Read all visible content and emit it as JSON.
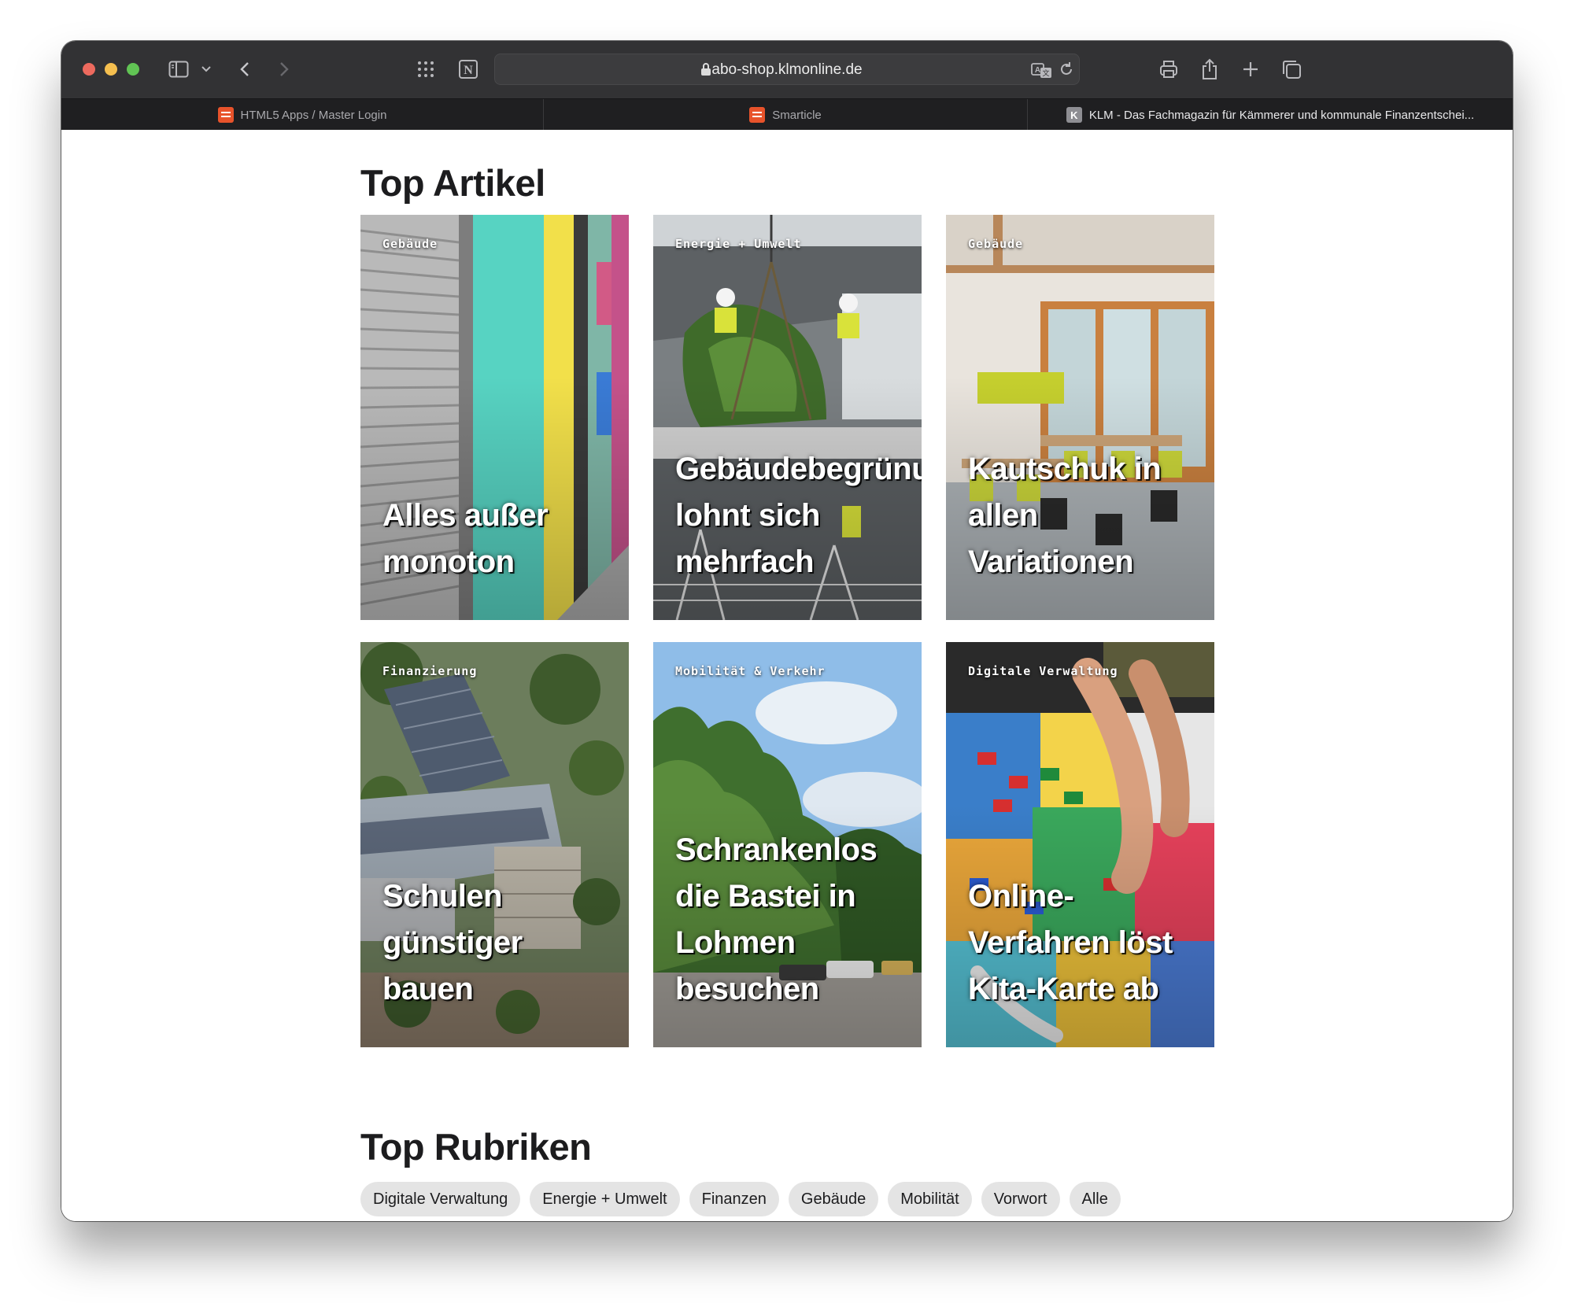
{
  "browser": {
    "url": "abo-shop.klmonline.de",
    "tabs": [
      {
        "label": "HTML5 Apps / Master Login",
        "favicon": "html5-apps-favicon"
      },
      {
        "label": "Smarticle",
        "favicon": "smarticle-favicon"
      },
      {
        "label": "KLM - Das Fachmagazin für Kämmerer und kommunale Finanzentschei...",
        "favicon": "klm-favicon",
        "active": true
      }
    ],
    "icons": [
      "sidebar-icon",
      "chevron-down-icon",
      "back-icon",
      "forward-icon",
      "grid-icon",
      "notion-icon",
      "lock-icon",
      "translate-icon",
      "reload-icon",
      "print-icon",
      "share-icon",
      "new-tab-icon",
      "tab-overview-icon"
    ]
  },
  "top_articles": {
    "title": "Top Artikel",
    "cards": [
      {
        "kicker": "Gebäude",
        "headline": "Alles außer monoton"
      },
      {
        "kicker": "Energie + Umwelt",
        "headline": "Gebäudebegrünung lohnt sich mehrfach"
      },
      {
        "kicker": "Gebäude",
        "headline": "Kautschuk in allen Variationen"
      },
      {
        "kicker": "Finanzierung",
        "headline": "Schulen günstiger bauen"
      },
      {
        "kicker": "Mobilität & Verkehr",
        "headline": "Schrankenlos die Bastei in Lohmen besuchen"
      },
      {
        "kicker": "Digitale Verwaltung",
        "headline": "Online-Verfahren löst Kita-Karte ab"
      }
    ]
  },
  "top_rubriken": {
    "title": "Top Rubriken",
    "chips": [
      "Digitale Verwaltung",
      "Energie + Umwelt",
      "Finanzen",
      "Gebäude",
      "Mobilität",
      "Vorwort",
      "Alle"
    ]
  }
}
